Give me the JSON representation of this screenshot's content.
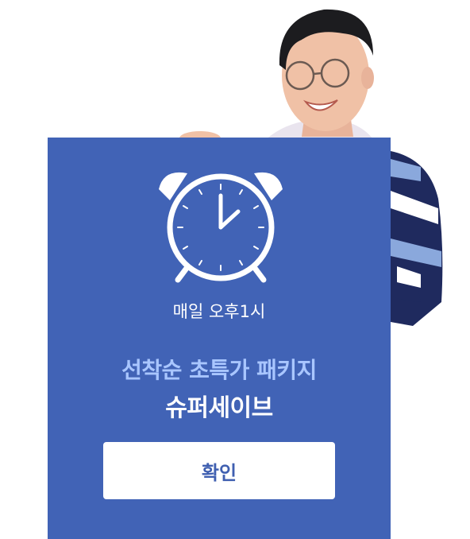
{
  "banner": {
    "schedule_text": "매일 오후1시",
    "subtitle": "선착순 초특가 패키지",
    "title": "슈퍼세이브",
    "confirm_label": "확인"
  },
  "colors": {
    "card_background": "#4163b6",
    "subtitle": "#a9c6ff",
    "title": "#ffffff",
    "button_background": "#ffffff",
    "button_text": "#3f5fb0"
  },
  "icons": [
    "alarm-clock-icon"
  ]
}
